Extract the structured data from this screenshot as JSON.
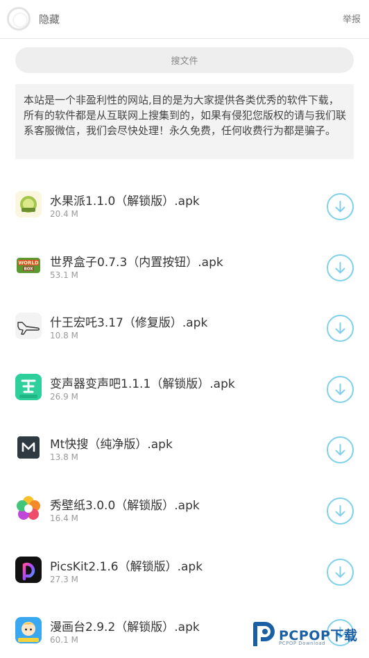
{
  "header": {
    "title": "隐藏",
    "report_label": "举报"
  },
  "search": {
    "placeholder": "搜文件"
  },
  "notice": {
    "text": "本站是一个非盈利性的网站,目的是为大家提供各类优秀的软件下载，所有的软件都是从互联网上搜集到的，如果有侵犯您版权的请与我们联系客服微信，我们会尽快处理！永久免费，任何收费行为都是骗子。"
  },
  "files": [
    {
      "name": "水果派1.1.0（解锁版）.apk",
      "size": "20.4 M",
      "icon": "fruit-icon",
      "color": "#d8e07a"
    },
    {
      "name": "世界盒子0.7.3（内置按钮）.apk",
      "size": "53.1 M",
      "icon": "worldbox-icon",
      "color": "#4e8b2f"
    },
    {
      "name": "什王宏吒3.17（修复版）.apk",
      "size": "10.8 M",
      "icon": "airplane-icon",
      "color": "#f2f2f2"
    },
    {
      "name": "变声器变声吧1.1.1（解锁版）.apk",
      "size": "26.9 M",
      "icon": "voice-changer-icon",
      "color": "#2dcf9a"
    },
    {
      "name": "Mt快搜（纯净版）.apk",
      "size": "13.8 M",
      "icon": "mt-search-icon",
      "color": "#2e3942"
    },
    {
      "name": "秀壁纸3.0.0（解锁版）.apk",
      "size": "16.4 M",
      "icon": "wallpaper-flower-icon",
      "color": "#f04d6a"
    },
    {
      "name": "PicsKit2.1.6（解锁版）.apk",
      "size": "27.3 M",
      "icon": "picskit-icon",
      "color": "#1a1a1a"
    },
    {
      "name": "漫画台2.9.2（解锁版）.apk",
      "size": "60.1 M",
      "icon": "manhuatai-icon",
      "color": "#3aa8f0"
    }
  ],
  "brand": {
    "name": "PCPOP下载",
    "sub": "PCPOP Download"
  },
  "colors": {
    "download_ring": "#7fd0ec",
    "brand": "#1a5fa3"
  }
}
